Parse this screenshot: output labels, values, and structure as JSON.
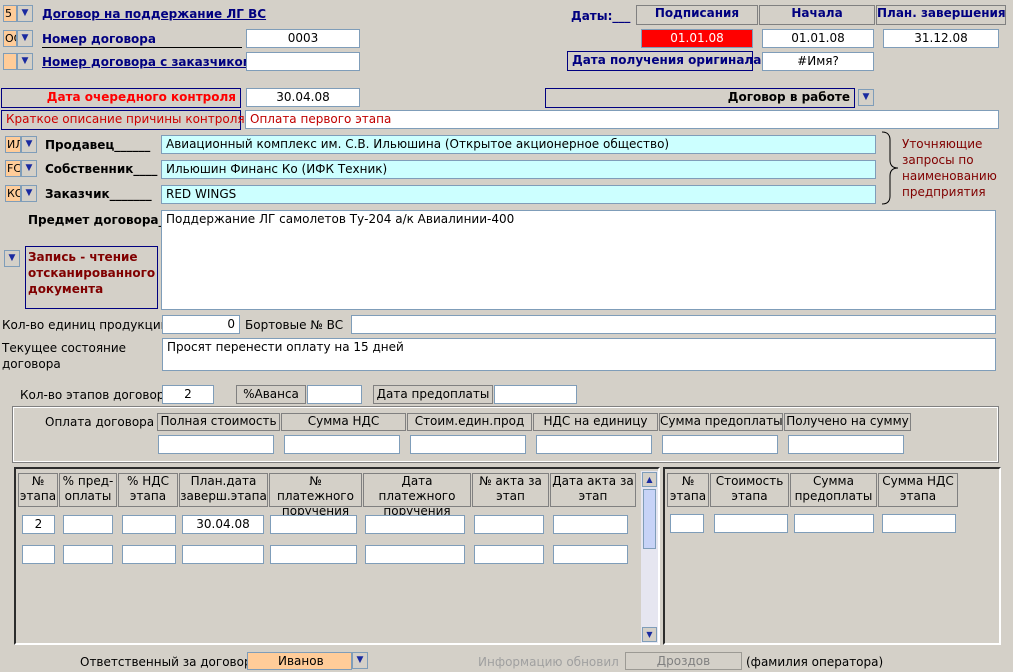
{
  "header": {
    "dogovor_title": "Договор на поддержание ЛГ ВС",
    "dogovor_code": "5",
    "nomer_label": "Номер договора",
    "nomer_code": "ОС",
    "nomer_value": "0003",
    "nomer_zak_label": "Номер договора с заказчиком",
    "nomer_zak_value": "",
    "dates_label": "Даты:___",
    "col_signing": "Подписания",
    "col_start": "Начала",
    "col_end": "План. завершения",
    "date_signing": "01.01.08",
    "date_start": "01.01.08",
    "date_end": "31.12.08",
    "original_label": "Дата получения оригинала",
    "original_value": "#Имя?"
  },
  "control": {
    "next_label": "Дата очередного контроля",
    "next_value": "30.04.08",
    "reason_label": "Краткое описание причины контроля",
    "reason_value": "Оплата первого этапа",
    "status_value": "Договор в работе"
  },
  "parties": {
    "seller_label": "Продавец______",
    "seller_code": "ИЛ",
    "seller_value": "Авиационный комплекс им. С.В. Ильюшина (Открытое акционерное общество)",
    "owner_label": "Собственник____",
    "owner_code": "FC",
    "owner_value": "Ильюшин Финанс Ко (ИФК Техник)",
    "customer_label": "Заказчик_______",
    "customer_code": "КО",
    "customer_value": "RED WINGS",
    "note": [
      "Уточняющие",
      "запросы по",
      "наименованию",
      "предприятия"
    ]
  },
  "subject": {
    "label": "Предмет договора_",
    "value": "Поддержание ЛГ самолетов Ту-204 а/к Авиалинии-400",
    "scan_label": [
      "Запись - чтение",
      "отсканированного",
      "документа"
    ]
  },
  "units": {
    "count_label": "Кол-во единиц продукции",
    "count_value": "0",
    "board_label": "Бортовые № ВС",
    "board_value": "",
    "state_label": [
      "Текущее состояние",
      "договора"
    ],
    "state_value": "Просят перенести оплату на 15 дней"
  },
  "stages": {
    "count_label": "Кол-во этапов договора",
    "count_value": "2",
    "advance_label": "%Аванса",
    "advance_value": "",
    "prepay_label": "Дата предоплаты",
    "prepay_value": ""
  },
  "payment": {
    "label": "Оплата договора",
    "columns": [
      "Полная стоимость",
      "Сумма НДС",
      "Стоим.един.прод",
      "НДС на единицу",
      "Сумма предоплаты",
      "Получено на сумму"
    ]
  },
  "table_left": {
    "columns": [
      [
        "№",
        "этапа"
      ],
      [
        "% пред-",
        "оплаты"
      ],
      [
        "% НДС",
        "этапа"
      ],
      [
        "План.дата",
        "заверш.этапа"
      ],
      [
        "№ платежного",
        "поручения"
      ],
      [
        "Дата платежного",
        "поручения"
      ],
      [
        "№ акта за",
        "этап"
      ],
      [
        "Дата акта за",
        "этап"
      ]
    ],
    "rows": [
      [
        "2",
        "",
        "",
        "30.04.08",
        "",
        "",
        "",
        ""
      ],
      [
        "",
        "",
        "",
        "",
        "",
        "",
        "",
        ""
      ]
    ]
  },
  "table_right": {
    "columns": [
      [
        "№",
        "этапа"
      ],
      [
        "Стоимость",
        "этапа"
      ],
      [
        "Сумма",
        "предоплаты"
      ],
      [
        "Сумма НДС",
        "этапа"
      ]
    ]
  },
  "footer": {
    "resp_label": "Ответственный за договор",
    "resp_value": "Иванов",
    "updated_label": "Информацию обновил",
    "updated_value": "Дроздов",
    "operator_note": "(фамилия оператора)"
  },
  "colors": {
    "background": "#d4d0c8",
    "accent_red": "#ff0000",
    "cyan_field": "#ccffff",
    "orange_combo": "#ffcc99",
    "navy": "#000080",
    "maroon": "#800000"
  }
}
